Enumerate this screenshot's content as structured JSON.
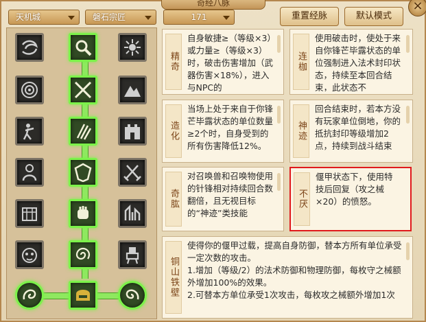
{
  "window": {
    "title": "奇经八脉",
    "close_symbol": "×"
  },
  "toolbar": {
    "sect": "天机城",
    "school": "磐石宗匠",
    "level": "171",
    "reset_label": "重置经脉",
    "default_label": "默认模式"
  },
  "colors": {
    "active_border": "#7cf24a",
    "highlight_border": "#e0191c",
    "name_color": "#7b4418"
  },
  "skill_tree": {
    "rows": [
      {
        "left": "spiral-wind-icon",
        "center": "magnifier-gear-icon",
        "right": "sun-rune-icon"
      },
      {
        "left": "target-eye-icon",
        "center": "crossed-swords-icon",
        "right": "mountain-icon"
      },
      {
        "left": "fighting-figure-icon",
        "center": "claw-strike-icon",
        "right": "fortress-wall-icon"
      },
      {
        "left": "armored-guard-icon",
        "center": "shield-crest-icon",
        "right": "crossed-blades-icon"
      },
      {
        "left": "gate-beast-icon",
        "center": "iron-fist-icon",
        "right": "ruins-icon"
      },
      {
        "left": "monkey-face-icon",
        "center": "whirlwind-icon",
        "right": "mech-warrior-icon"
      },
      {
        "left": "dragon-orb-icon",
        "center": "helmet-icon",
        "right": "phoenix-orb-icon"
      }
    ]
  },
  "cards": [
    {
      "name": "精奇",
      "text": "自身敏捷≥（等级×3）或力量≥（等级×3）时，破击伤害增加（武器伤害×18%），进入与NPC的"
    },
    {
      "name": "连枷",
      "text": "使用破击时，使处于来自你锋芒毕露状态的单位强制进入法术封印状态，持续至本回合结束，此状态不"
    },
    {
      "name": "造化",
      "text": "当场上处于来自于你锋芒毕露状态的单位数量≥2个时，自身受到的所有伤害降低12%。"
    },
    {
      "name": "神迹",
      "text": "回合结束时，若本方没有玩家单位倒地，你的抵抗封印等级增加2点，持续到战斗结束"
    },
    {
      "name": "奇肱",
      "text": "对召唤兽和召唤物使用的针锋相对持续回合数翻倍，且无视目标的“神迹”类技能"
    },
    {
      "name": "不厌",
      "text": "偃甲状态下，使用特技后回复（攻之械×20）的愤怒。"
    },
    {
      "name": "铜山铁壁",
      "text": "使得你的偃甲过载，提高自身防御，替本方所有单位承受一定次数的攻击。\n1.增加（等级/2）的法术防御和物理防御，每枚守之械额外增加100%的效果。\n2.可替本方单位承受1次攻击，每枚攻之械额外增加1次"
    }
  ]
}
